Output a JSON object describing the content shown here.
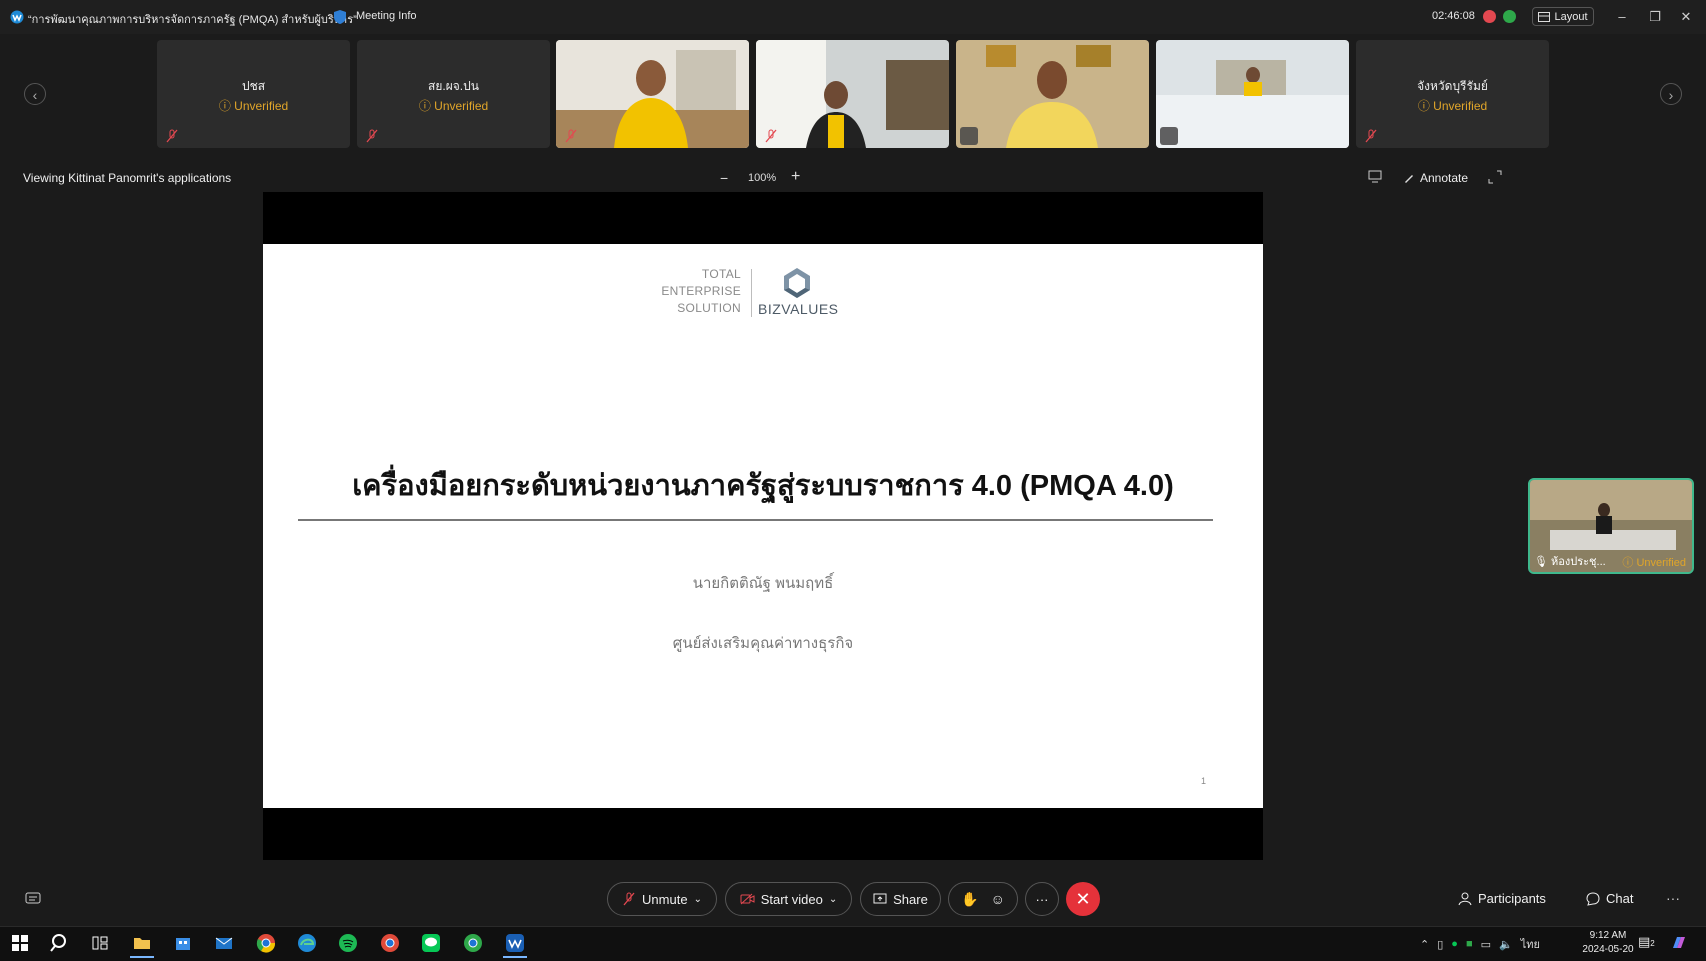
{
  "window": {
    "title": "“การพัฒนาคุณภาพการบริหารจัดการภาครัฐ (PMQA) สำหรับผู้บริหาร”",
    "meeting_info": "Meeting Info",
    "timer": "02:46:08",
    "layout_label": "Layout",
    "minimize": "–",
    "restore": "❐",
    "close": "✕"
  },
  "participants": {
    "prev_arrow": "‹",
    "next_arrow": "›",
    "tiles": [
      {
        "name": "ปชส",
        "status": "Unverified"
      },
      {
        "name": "สย.ผจ.ปน",
        "status": "Unverified"
      },
      {
        "name": "",
        "status": ""
      },
      {
        "name": "",
        "status": ""
      },
      {
        "name": "",
        "status": ""
      },
      {
        "name": "",
        "status": ""
      },
      {
        "name": "จังหวัดบุรีรัมย์",
        "status": "Unverified"
      }
    ]
  },
  "share_toolbar": {
    "viewing_label": "Viewing Kittinat Panomrit's applications",
    "zoom_out": "−",
    "zoom_level": "100%",
    "zoom_in": "+",
    "annotate_label": "Annotate"
  },
  "slide": {
    "logo_tagline_1": "TOTAL",
    "logo_tagline_2": "ENTERPRISE",
    "logo_tagline_3": "SOLUTION",
    "logo_text": "BIZVALUES",
    "title": "เครื่องมือยกระดับหน่วยงานภาครัฐสู่ระบบราชการ 4.0 (PMQA 4.0)",
    "presenter": "นายกิตติณัฐ พนมฤทธิ์",
    "organization": "ศูนย์ส่งเสริมคุณค่าทางธุรกิจ",
    "page_number": "1"
  },
  "self_view": {
    "label": "ห้องประชุ...",
    "status": "Unverified"
  },
  "controls": {
    "unmute": "Unmute",
    "start_video": "Start video",
    "share": "Share",
    "more": "···",
    "end": "✕",
    "participants": "Participants",
    "chat": "Chat",
    "overflow": "···"
  },
  "taskbar": {
    "language": "ไทย",
    "time": "9:12 AM",
    "date": "2024-05-20",
    "notification_count": "2"
  },
  "colors": {
    "unverified": "#e0a52a",
    "end_button": "#e5323a",
    "self_view_border": "#3fb88c"
  }
}
